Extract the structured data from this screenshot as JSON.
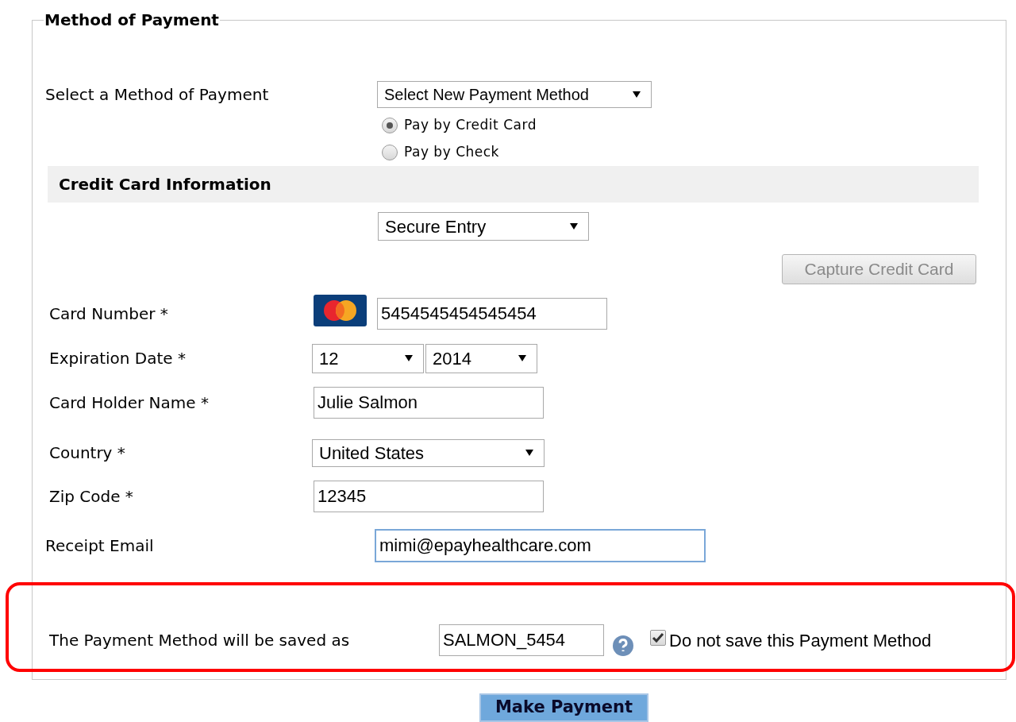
{
  "section": {
    "legend": "Method of Payment"
  },
  "method": {
    "label": "Select a Method of Payment",
    "select": "Select New Payment Method",
    "options": [
      {
        "label": "Pay by Credit Card",
        "selected": true
      },
      {
        "label": "Pay by Check",
        "selected": false
      }
    ]
  },
  "card_section": {
    "heading": "Credit Card Information",
    "entry_mode": "Secure Entry",
    "capture_button": {
      "label": "Capture Credit Card",
      "disabled": true
    },
    "fields": [
      {
        "kind": "card",
        "label": "Card Number *",
        "value": "5454545454545454"
      },
      {
        "kind": "expiry",
        "label": "Expiration Date *",
        "month": "12",
        "year": "2014"
      },
      {
        "kind": "text",
        "label": "Card Holder Name *",
        "value": "Julie Salmon"
      },
      {
        "kind": "select",
        "label": "Country *",
        "value": "United States"
      },
      {
        "kind": "text",
        "label": "Zip Code *",
        "value": "12345"
      },
      {
        "kind": "email",
        "label": "Receipt Email",
        "value": "mimi@epayhealthcare.com",
        "focused": true
      }
    ]
  },
  "save": {
    "label": "The Payment Method will be saved as",
    "value": "SALMON_5454",
    "do_not_save": {
      "label": "Do not save this Payment Method",
      "checked": true
    }
  },
  "submit": "Make Payment"
}
